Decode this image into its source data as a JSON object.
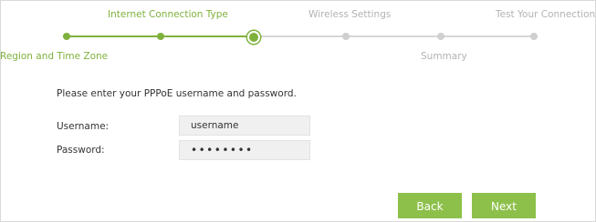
{
  "wizard": {
    "steps_top": [
      {
        "label": "Internet Connection Type",
        "state": "done"
      },
      {
        "label": "Wireless Settings",
        "state": "todo"
      },
      {
        "label": "Test Your Connection",
        "state": "todo"
      }
    ],
    "steps_bottom": [
      {
        "label": "Region and Time Zone",
        "state": "done"
      },
      {
        "label": "Summary",
        "state": "todo"
      }
    ]
  },
  "form": {
    "prompt": "Please enter your PPPoE username and password.",
    "username_label": "Username:",
    "username_value": "username",
    "password_label": "Password:",
    "password_value": "••••••••"
  },
  "buttons": {
    "back": "Back",
    "next": "Next"
  },
  "colors": {
    "accent": "#7fb13d",
    "button": "#8dc04a",
    "inactive": "#b3b3b3"
  }
}
